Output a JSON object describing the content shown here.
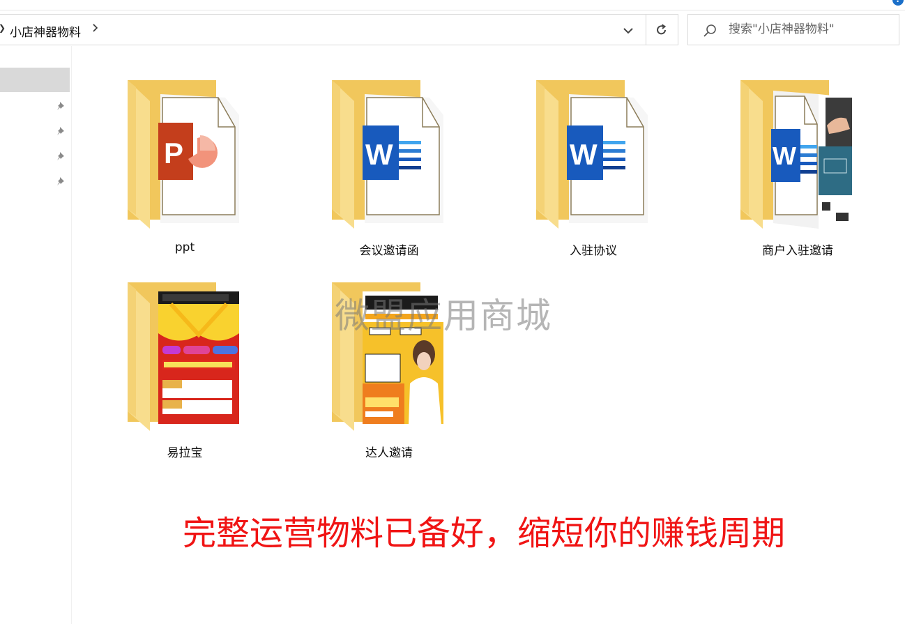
{
  "breadcrumb": {
    "current": "小店神器物料"
  },
  "search": {
    "placeholder": "搜索\"小店神器物料\""
  },
  "help": {
    "glyph": "?"
  },
  "files": [
    {
      "name": "ppt",
      "icon": "powerpoint-folder-icon"
    },
    {
      "name": "会议邀请函",
      "icon": "word-folder-icon"
    },
    {
      "name": "入驻协议",
      "icon": "word-folder-icon"
    },
    {
      "name": "商户入驻邀请",
      "icon": "word-preview-folder-icon"
    },
    {
      "name": "易拉宝",
      "icon": "poster-folder-icon"
    },
    {
      "name": "达人邀请",
      "icon": "poster-folder-icon"
    }
  ],
  "watermark": "微盟应用商城",
  "tagline": "完整运营物料已备好，缩短你的赚钱周期",
  "colors": {
    "folder": "#f6d67a",
    "powerpoint": "#c43e1c",
    "word": "#185abd",
    "tagline": "#f01414"
  }
}
